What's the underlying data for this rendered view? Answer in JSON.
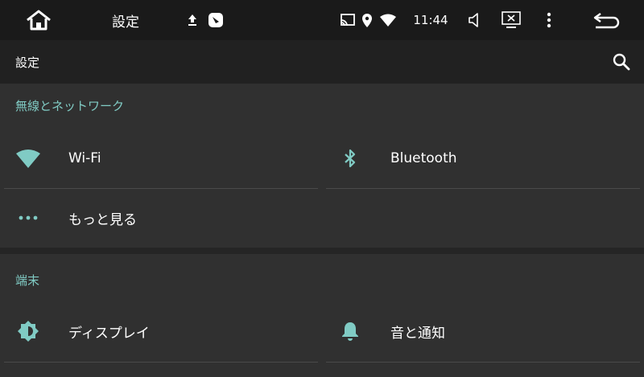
{
  "status_bar": {
    "title": "設定",
    "clock": "11:44",
    "icons": [
      "home-icon",
      "upload-icon",
      "notification-icon",
      "cast-icon",
      "location-icon",
      "wifi-icon",
      "volume-icon",
      "screen-close-icon",
      "more-icon",
      "back-icon"
    ]
  },
  "app_bar": {
    "title": "設定",
    "search_icon": "search-icon"
  },
  "sections": [
    {
      "header": "無線とネットワーク",
      "tiles": [
        {
          "label": "Wi-Fi",
          "icon": "wifi-icon"
        },
        {
          "label": "Bluetooth",
          "icon": "bluetooth-icon"
        },
        {
          "label": "もっと見る",
          "icon": "more-horiz-icon"
        }
      ]
    },
    {
      "header": "端末",
      "tiles": [
        {
          "label": "ディスプレイ",
          "icon": "brightness-icon"
        },
        {
          "label": "音と通知",
          "icon": "bell-icon"
        }
      ]
    }
  ],
  "colors": {
    "accent": "#80cbc4",
    "background": "#303030",
    "status_bar": "#1a1a1a",
    "app_bar": "#212121"
  }
}
